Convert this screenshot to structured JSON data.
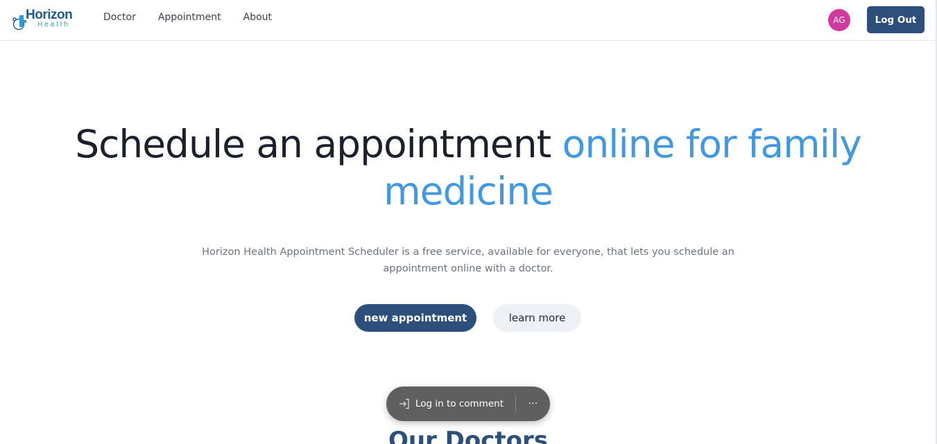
{
  "header": {
    "logo": {
      "word1": "Horizon",
      "word2": "Health"
    },
    "nav": [
      {
        "label": "Doctor"
      },
      {
        "label": "Appointment"
      },
      {
        "label": "About"
      }
    ],
    "avatar_initials": "AG",
    "logout_label": "Log Out"
  },
  "hero": {
    "title_main": "Schedule an appointment ",
    "title_accent": "online for family medicine",
    "subtitle": "Horizon Health Appointment Scheduler is a free service, available for everyone, that lets you schedule an appointment online with a doctor.",
    "primary_button": "new appointment",
    "secondary_button": "learn more"
  },
  "doctors_section": {
    "heading": "Our Doctors"
  },
  "comment_bar": {
    "login_label": "Log in to comment",
    "more_label": "···"
  },
  "colors": {
    "brand_navy": "#2c4f7c",
    "accent_blue": "#4299e1",
    "avatar_pink": "#d2399f",
    "pill_gray": "#5f5f5f"
  }
}
